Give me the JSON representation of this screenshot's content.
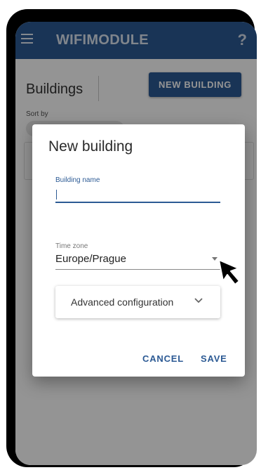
{
  "app": {
    "title": "WIFIMODULE",
    "help": "?",
    "accent_color": "#2c5a94"
  },
  "page": {
    "title": "Buildings",
    "new_button": "NEW BUILDING",
    "sort_label": "Sort by"
  },
  "dialog": {
    "title": "New building",
    "name_label": "Building name",
    "name_value": "",
    "timezone_label": "Time zone",
    "timezone_value": "Europe/Prague",
    "advanced_label": "Advanced configuration",
    "cancel": "CANCEL",
    "save": "SAVE"
  },
  "icons": {
    "menu": "menu-icon",
    "help": "help-icon",
    "dropdown": "dropdown-arrow-icon",
    "chevron": "chevron-down-icon",
    "pointer": "mouse-pointer-icon"
  }
}
